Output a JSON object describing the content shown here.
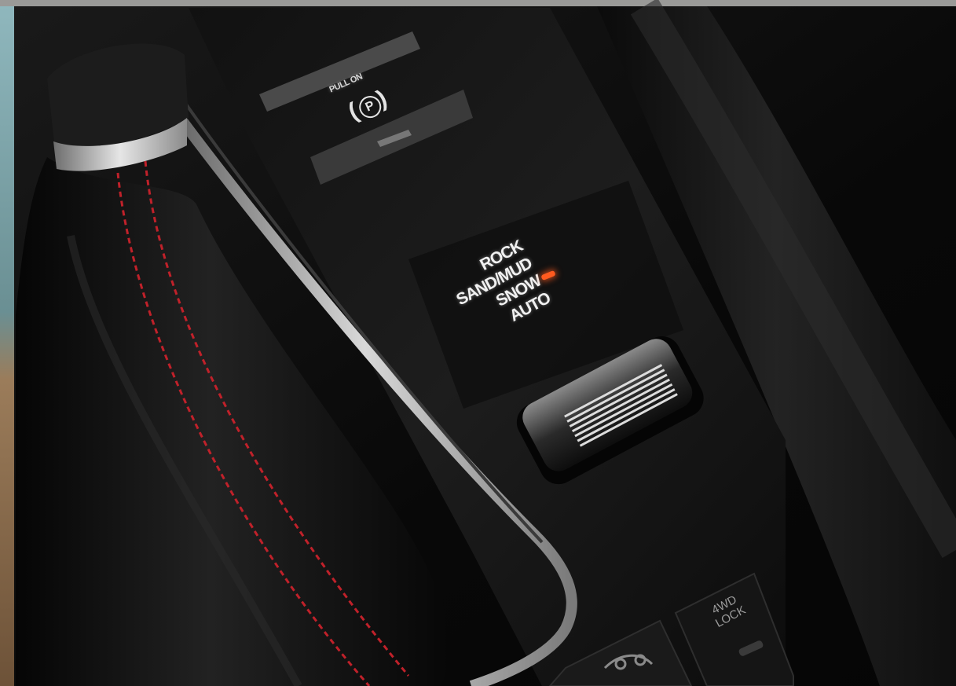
{
  "parking_brake": {
    "label": "PULL ON",
    "symbol": "P"
  },
  "terrain_selector": {
    "modes": [
      "ROCK",
      "SAND/MUD",
      "SNOW",
      "AUTO"
    ],
    "active_indicator_color": "#ff5a1f"
  },
  "lock_button": {
    "line1": "4WD",
    "line2": "LOCK"
  },
  "colors": {
    "stitching": "#c0212a",
    "leather": "#141414",
    "trim": "#c9c9c9"
  },
  "icons": [
    "parking-brake-icon",
    "mode-indicator-led",
    "hill-descent-icon",
    "dial-grip"
  ]
}
